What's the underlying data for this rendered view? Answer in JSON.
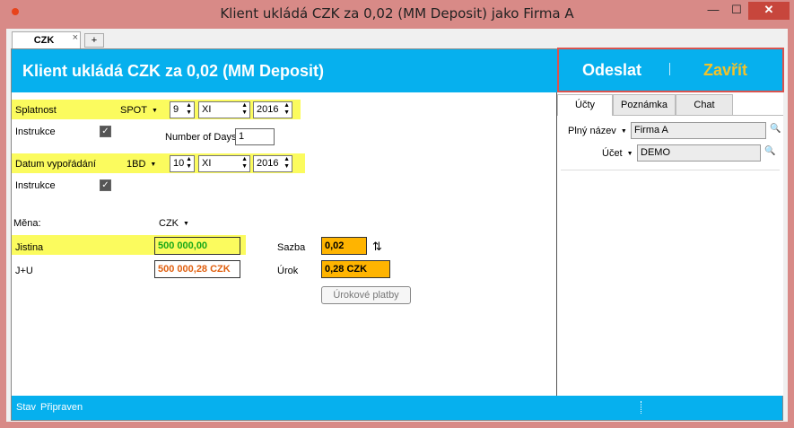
{
  "window": {
    "title": "Klient ukládá CZK za 0,02 (MM Deposit) jako Firma A",
    "minimize": "—",
    "maximize": "☐",
    "close": "✕"
  },
  "tabs": {
    "doc_tab": "CZK",
    "doc_tab_close": "×",
    "add_tab": "+"
  },
  "header": {
    "title": "Klient ukládá CZK za 0,02 (MM Deposit)",
    "send_label": "Odeslat",
    "close_label": "Zavřít",
    "separator": "¦"
  },
  "form": {
    "maturity_label": "Splatnost",
    "maturity_type": "SPOT",
    "maturity_day": "9",
    "maturity_month": "XI",
    "maturity_year": "2016",
    "instruction_label_1": "Instrukce",
    "instruction_checked_1": true,
    "days_label": "Number of Days",
    "days_value": "1",
    "settlement_label": "Datum vypořádání",
    "settlement_type": "1BD",
    "settlement_day": "10",
    "settlement_month": "XI",
    "settlement_year": "2016",
    "instruction_label_2": "Instrukce",
    "instruction_checked_2": true,
    "currency_label": "Měna:",
    "currency_value": "CZK",
    "principal_label": "Jistina",
    "principal_value": "500 000,00",
    "ju_label": "J+U",
    "ju_value": "500 000,28 CZK",
    "rate_label": "Sazba",
    "rate_value": "0,02",
    "interest_label": "Úrok",
    "interest_value": "0,28 CZK",
    "interest_button": "Úrokové platby",
    "check_glyph": "✓",
    "spin_glyph": "▲▼",
    "swap_glyph": "⇅"
  },
  "side": {
    "tabs": [
      "Účty",
      "Poznámka",
      "Chat"
    ],
    "full_name_label": "Plný název",
    "full_name_value": "Firma A",
    "account_label": "Účet",
    "account_value": "DEMO",
    "search_glyph": "🔍"
  },
  "status": {
    "label": "Stav",
    "value": "Připraven"
  },
  "colors": {
    "accent": "#06b0ee",
    "highlight": "#fbfb5e",
    "rate_fill": "#ffb400",
    "principal_text": "#18a818",
    "ju_text": "#e06010",
    "close_label": "#f2c22a"
  }
}
